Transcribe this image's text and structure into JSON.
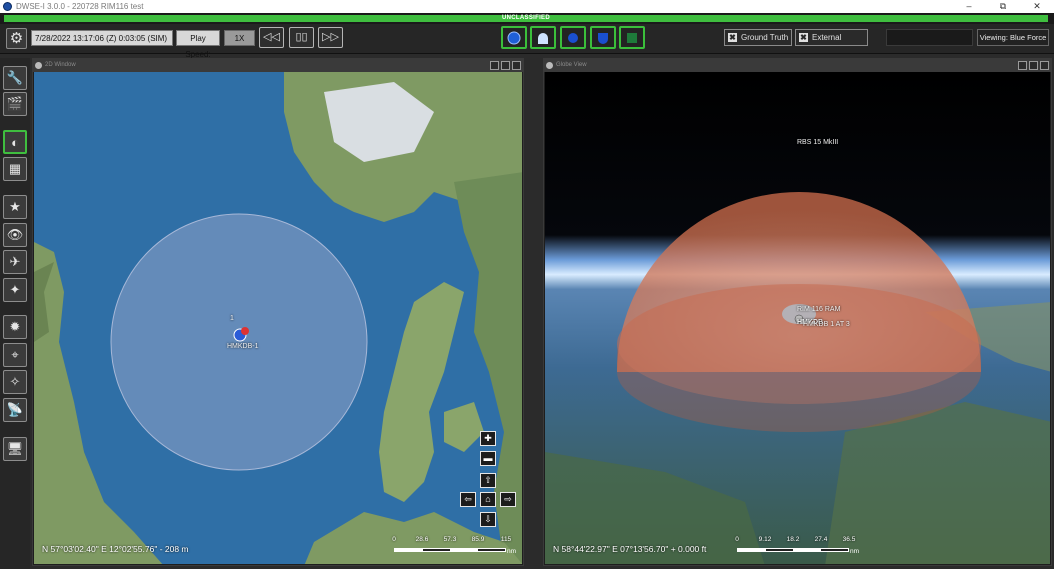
{
  "window": {
    "title": "DWSE-I 3.0.0 - 220728 RIM116 test",
    "controls": [
      "–",
      "⧉",
      "✕"
    ]
  },
  "classification": "UNCLASSIFIED",
  "toolbar": {
    "sim_time": "7/28/2022 13:17:06 (Z) 0:03:05 (SIM)",
    "play_speed_label": "Play Speed:",
    "speed_value": "1X",
    "rewind_icon": "◁◁",
    "pause_icon": "▯▯",
    "fast_forward_icon": "▷▷",
    "ground_truth_label": "Ground Truth",
    "external_label": "External",
    "viewing_label": "Viewing: Blue Force",
    "ground_truth_checked": true,
    "external_checked": true,
    "accent_color": "#3fbe3f"
  },
  "sidebar": {
    "icons": [
      "wrench-icon",
      "clapperboard-icon",
      "globe-2d-icon",
      "map-screen-icon",
      "star-list-icon",
      "eye-icon",
      "satellite-icon",
      "star-person-icon",
      "gear-star-icon",
      "telescope-icon",
      "telescope-star-icon",
      "satellite-dish-icon",
      "monitor-camera-icon"
    ]
  },
  "map2d": {
    "header": "2D Window",
    "coordinates": "N 57°03'02.40\" E 12°02'55.76\" - 208 m",
    "entity_label": "HMKDB-1",
    "entity_number": "1",
    "scale_ticks": [
      "0",
      "28.6",
      "57.3",
      "85.9",
      "115"
    ],
    "scale_unit": "nm",
    "nav_labels": {
      "zoom_in": "✚",
      "zoom_out": "▬",
      "up": "⇧",
      "left": "⇦",
      "home": "⌂",
      "right": "⇨",
      "down": "⇩"
    }
  },
  "globe": {
    "header": "Globe View",
    "coordinates": "N 58°44'22.97\" E 07°13'56.70\" + 0.000 ft",
    "dome_label": "RBS 15 MkIII",
    "rim_label": "RIM 116 RAM",
    "entity_label_a": "HMKDB",
    "entity_label_b": "HMKDB 1 AT 3",
    "scale_ticks": [
      "0",
      "9.12",
      "18.2",
      "27.4",
      "36.5"
    ],
    "scale_unit": "nm"
  }
}
